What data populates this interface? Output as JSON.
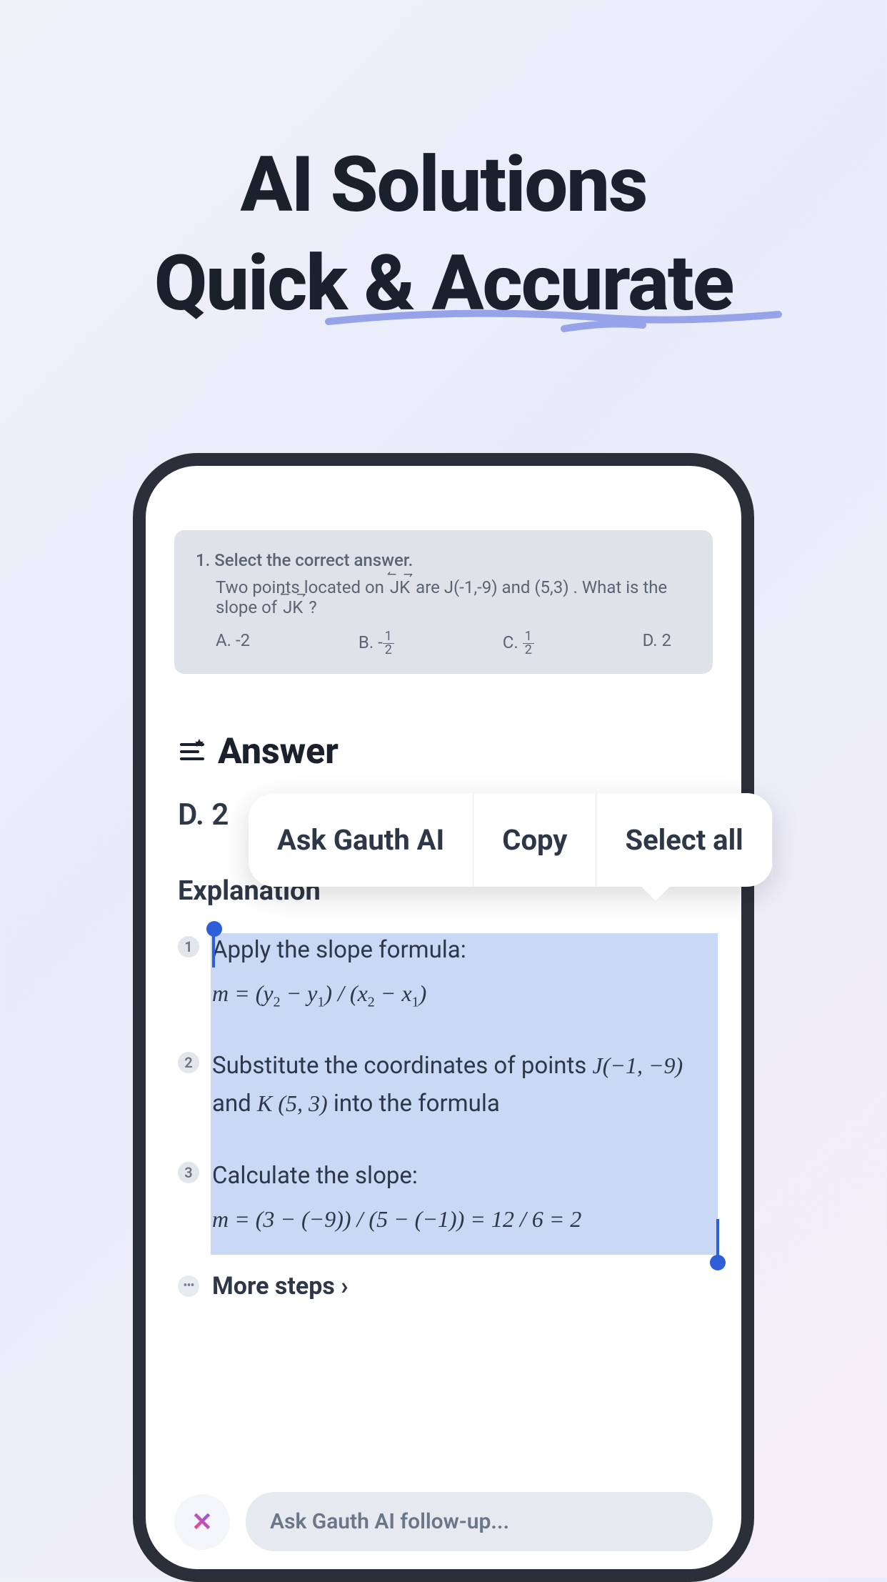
{
  "headline": {
    "line1": "AI Solutions",
    "line2": "Quick & Accurate"
  },
  "question": {
    "prompt": "1. Select the correct answer.",
    "text_part1": "Two points located on ",
    "text_jk1": "JK",
    "text_part2": " are J(-1,-9) and (5,3) . What is the slope of ",
    "text_jk2": "JK",
    "text_part3": " ?",
    "options": {
      "a": "A. -2",
      "b_prefix": "B. -",
      "b_num": "1",
      "b_den": "2",
      "c_prefix": "C. ",
      "c_num": "1",
      "c_den": "2",
      "d": "D. 2"
    }
  },
  "answer": {
    "header": "Answer",
    "value": "D. 2"
  },
  "explanation": {
    "title": "Explanation",
    "steps": [
      {
        "num": "1",
        "text": "Apply the slope formula:",
        "formula_parts": [
          "m = (y",
          "2",
          " − y",
          "1",
          ") / (x",
          "2",
          " − x",
          "1",
          ")"
        ]
      },
      {
        "num": "2",
        "text_part1": "Substitute the coordinates of points ",
        "formula1": "J(−1, −9)",
        "text_part2": " and ",
        "formula2": "K (5, 3)",
        "text_part3": " into the formula"
      },
      {
        "num": "3",
        "text": "Calculate the slope:",
        "formula": "m = (3 − (−9)) / (5 − (−1)) = 12 / 6 = 2"
      }
    ]
  },
  "more_steps": {
    "label": "More steps ›"
  },
  "context_menu": {
    "ask": "Ask Gauth AI",
    "copy": "Copy",
    "select_all": "Select all"
  },
  "follow_up": {
    "placeholder": "Ask Gauth AI follow-up..."
  }
}
